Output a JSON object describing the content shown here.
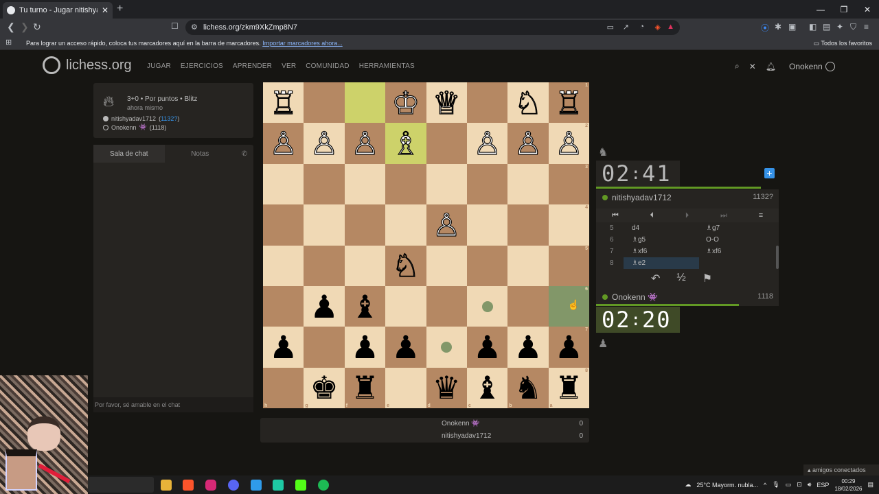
{
  "browser": {
    "tab_title": "Tu turno - Jugar nitishyadav1712 ...",
    "url": "lichess.org/zkm9XkZmp8N7",
    "bookmark_msg": "Para lograr un acceso rápido, coloca tus marcadores aquí en la barra de marcadores.",
    "bookmark_link": "Importar marcadores ahora...",
    "all_favorites": "Todos los favoritos"
  },
  "header": {
    "logo": "lichess.org",
    "nav": [
      "JUGAR",
      "EJERCICIOS",
      "APRENDER",
      "VER",
      "COMUNIDAD",
      "HERRAMIENTAS"
    ],
    "username": "Onokenn"
  },
  "game_info": {
    "mode": "3+0 • Por puntos • Blitz",
    "time_ago": "ahora mismo",
    "white_player": "nitishyadav1712",
    "white_rating": "1132?",
    "black_player": "Onokenn",
    "black_badge": "👾",
    "black_rating": "(1118)"
  },
  "chat": {
    "tab_chat": "Sala de chat",
    "tab_notes": "Notas",
    "placeholder": "Por favor, sé amable en el chat"
  },
  "board": {
    "orientation": "black",
    "ranks": [
      "1",
      "2",
      "3",
      "4",
      "5",
      "6",
      "7",
      "8"
    ],
    "files": [
      "h",
      "g",
      "f",
      "e",
      "d",
      "c",
      "b",
      "a"
    ],
    "rows": [
      [
        "♖",
        "",
        "",
        "♔",
        "♕",
        "",
        "♘",
        "♖"
      ],
      [
        "♙",
        "♙",
        "♙",
        "♗",
        "",
        "♙",
        "♙",
        "♙"
      ],
      [
        "",
        "",
        "",
        "",
        "",
        "",
        "",
        ""
      ],
      [
        "",
        "",
        "",
        "",
        "♙",
        "",
        "",
        ""
      ],
      [
        "",
        "",
        "",
        "♘",
        "",
        "",
        "",
        ""
      ],
      [
        "",
        "♟",
        "♝",
        "",
        "",
        "",
        "",
        ""
      ],
      [
        "♟",
        "",
        "♟",
        "♟",
        "",
        "♟",
        "♟",
        "♟"
      ],
      [
        "",
        "♚",
        "♜",
        "",
        "♛",
        "♝",
        "♞",
        "♜"
      ]
    ],
    "colors": [
      [
        "w",
        "",
        "",
        "w",
        "w",
        "",
        "w",
        "w"
      ],
      [
        "w",
        "w",
        "w",
        "w",
        "",
        "w",
        "w",
        "w"
      ],
      [
        "",
        "",
        "",
        "",
        "",
        "",
        "",
        ""
      ],
      [
        "",
        "",
        "",
        "",
        "w",
        "",
        "",
        ""
      ],
      [
        "",
        "",
        "",
        "w",
        "",
        "",
        "",
        ""
      ],
      [
        "",
        "b",
        "b",
        "",
        "",
        "",
        "",
        ""
      ],
      [
        "b",
        "",
        "b",
        "b",
        "",
        "b",
        "b",
        "b"
      ],
      [
        "",
        "b",
        "b",
        "",
        "b",
        "b",
        "b",
        "b"
      ]
    ]
  },
  "material": {
    "black_name": "Onokenn 👾",
    "black_score": "0",
    "white_name": "nitishyadav1712",
    "white_score": "0"
  },
  "right_panel": {
    "opp_clock_min": "02",
    "opp_clock_sec": "41",
    "opp_name": "nitishyadav1712",
    "opp_rating": "1132?",
    "my_clock_min": "02",
    "my_clock_sec": "20",
    "my_name": "Onokenn 👾",
    "my_rating": "1118",
    "moves": [
      {
        "n": "5",
        "w": "d4",
        "b": "♗g7"
      },
      {
        "n": "6",
        "w": "♗g5",
        "b": "O-O"
      },
      {
        "n": "7",
        "w": "♗xf6",
        "b": "♗xf6"
      },
      {
        "n": "8",
        "w": "♗e2",
        "b": ""
      }
    ]
  },
  "friends": "amigos conectados",
  "tray": {
    "weather": "25°C  Mayorm. nubla...",
    "lang": "ESP",
    "time": "00:29",
    "date": "18/02/2026"
  }
}
